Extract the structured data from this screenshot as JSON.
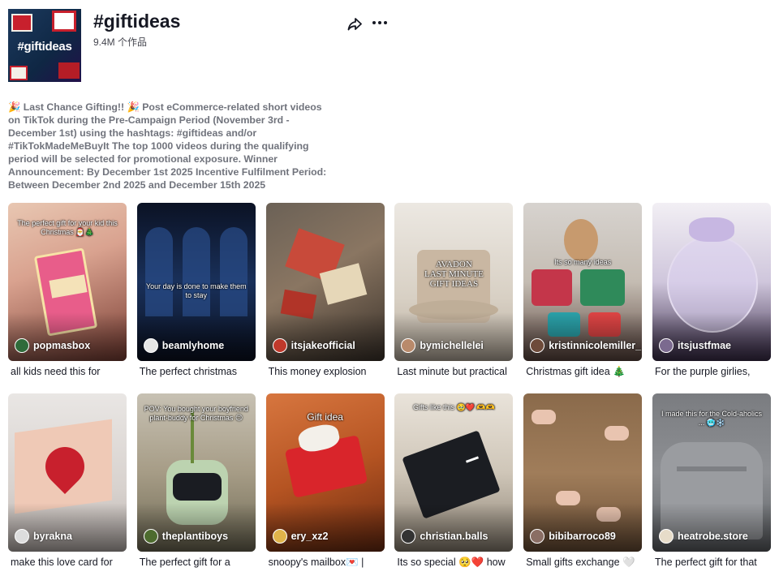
{
  "header": {
    "cover_tag": "#giftideas",
    "title": "#giftideas",
    "count": "9.4M 个作品",
    "description": "🎉 Last Chance Gifting!! 🎉 Post eCommerce-related short videos on TikTok during the Pre-Campaign Period (November 3rd - December 1st) using the hashtags: #giftideas and/or #TikTokMadeMeBuyIt The top 1000 videos during the qualifying period will be selected for promotional exposure. Winner Announcement: By December 1st 2025 Incentive Fulfilment Period: Between December 2nd 2025 and December 15th 2025"
  },
  "icons": {
    "share": "share-arrow-icon",
    "more": "more-dots-icon"
  },
  "videos": [
    {
      "username": "popmasbox",
      "caption": "all kids need this for",
      "overlay": "The perfect gift for your kid this Christmas 🎅🎄",
      "avatar_color": "#2f6b3a"
    },
    {
      "username": "beamlyhome",
      "caption": "The perfect christmas",
      "overlay": "Your day is done to make them to stay",
      "avatar_color": "#e6e6e6"
    },
    {
      "username": "itsjakeofficial",
      "caption": "This money explosion",
      "overlay": "",
      "avatar_color": "#c0392b"
    },
    {
      "username": "bymichellelei",
      "caption": "Last minute but practical",
      "overlay": "AVADON\nLAST MINUTE\nGIFT IDEAS",
      "avatar_color": "#b98a6b"
    },
    {
      "username": "kristinnicolemiller_",
      "caption": "Christmas gift idea 🎄",
      "overlay": "Its so many ideas",
      "avatar_color": "#6e4b3a"
    },
    {
      "username": "itsjustfmae",
      "caption": "For the purple girlies,",
      "overlay": "",
      "avatar_color": "#7b6a8f"
    },
    {
      "username": "byrakna",
      "caption": "make this love card for",
      "overlay": "",
      "avatar_color": "#dddddd"
    },
    {
      "username": "theplantiboys",
      "caption": "The perfect gift for a",
      "overlay": "POV: You bought your boyfriend plant-buddy for Christmas 😉",
      "avatar_color": "#4d6b2e"
    },
    {
      "username": "ery_xz2",
      "caption": "snoopy's mailbox💌 |",
      "overlay": "Gift idea",
      "avatar_color": "#e0b44a"
    },
    {
      "username": "christian.balls",
      "caption": "Its so special 🥺❤️ how",
      "overlay": "Gifts like this 🥹❤️ 🫶🫶",
      "avatar_color": "#333333"
    },
    {
      "username": "bibibarroco89",
      "caption": "Small gifts exchange 🤍",
      "overlay": "",
      "avatar_color": "#8a6e64"
    },
    {
      "username": "heatrobe.store",
      "caption": "The perfect gift for that",
      "overlay": "I made this for the Cold-aholics ... 🥶❄️",
      "avatar_color": "#e7dcc9"
    }
  ]
}
